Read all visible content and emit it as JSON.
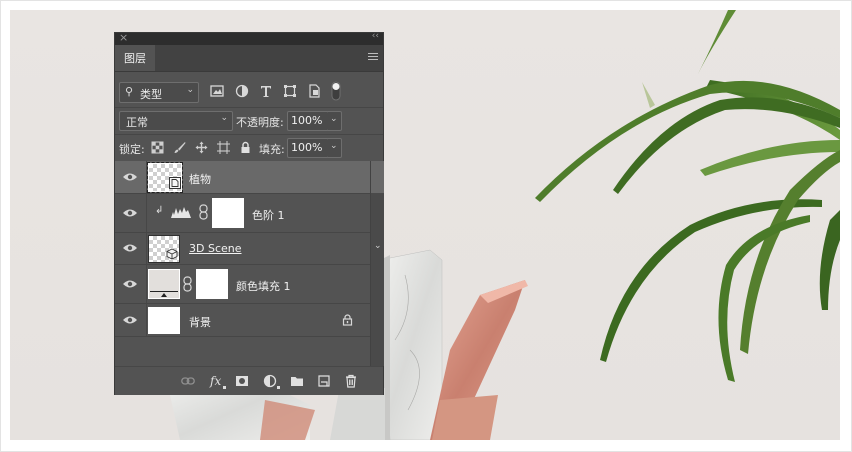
{
  "panel": {
    "tab_label": "图层",
    "filter": {
      "label": "类型",
      "icon": "search-icon"
    },
    "filter_icons": [
      "image-filter-icon",
      "adjustment-filter-icon",
      "type-filter-icon",
      "shape-filter-icon",
      "smart-object-filter-icon",
      "filter-toggle-icon"
    ],
    "blend_mode": "正常",
    "opacity_label": "不透明度:",
    "opacity_value": "100%",
    "lock_label": "锁定:",
    "lock_icons": [
      "lock-transparent-pixels-icon",
      "lock-image-pixels-icon",
      "lock-position-icon",
      "lock-artboard-icon",
      "lock-all-icon"
    ],
    "fill_label": "填充:",
    "fill_value": "100%",
    "layers": [
      {
        "name": "植物",
        "type": "smart-object",
        "selected": true,
        "visible": true
      },
      {
        "name": "色阶 1",
        "type": "levels-adjustment",
        "clipped": true,
        "visible": true
      },
      {
        "name": "3D Scene",
        "type": "3d",
        "visible": true,
        "expandable": true
      },
      {
        "name": "颜色填充 1",
        "type": "color-fill",
        "visible": true
      },
      {
        "name": "背景",
        "type": "background",
        "locked": true,
        "visible": true
      }
    ],
    "footer_icons": [
      "link-layers-icon",
      "fx-icon",
      "add-mask-icon",
      "new-adjustment-icon",
      "new-group-icon",
      "new-layer-icon",
      "delete-layer-icon"
    ],
    "fx_label": "fx"
  },
  "colors": {
    "panel_bg": "#535353",
    "selected_row": "#696969",
    "canvas_bg": "#e8e4e1",
    "leaf_green": "#4c7a2c",
    "copper": "#d48f7e"
  }
}
